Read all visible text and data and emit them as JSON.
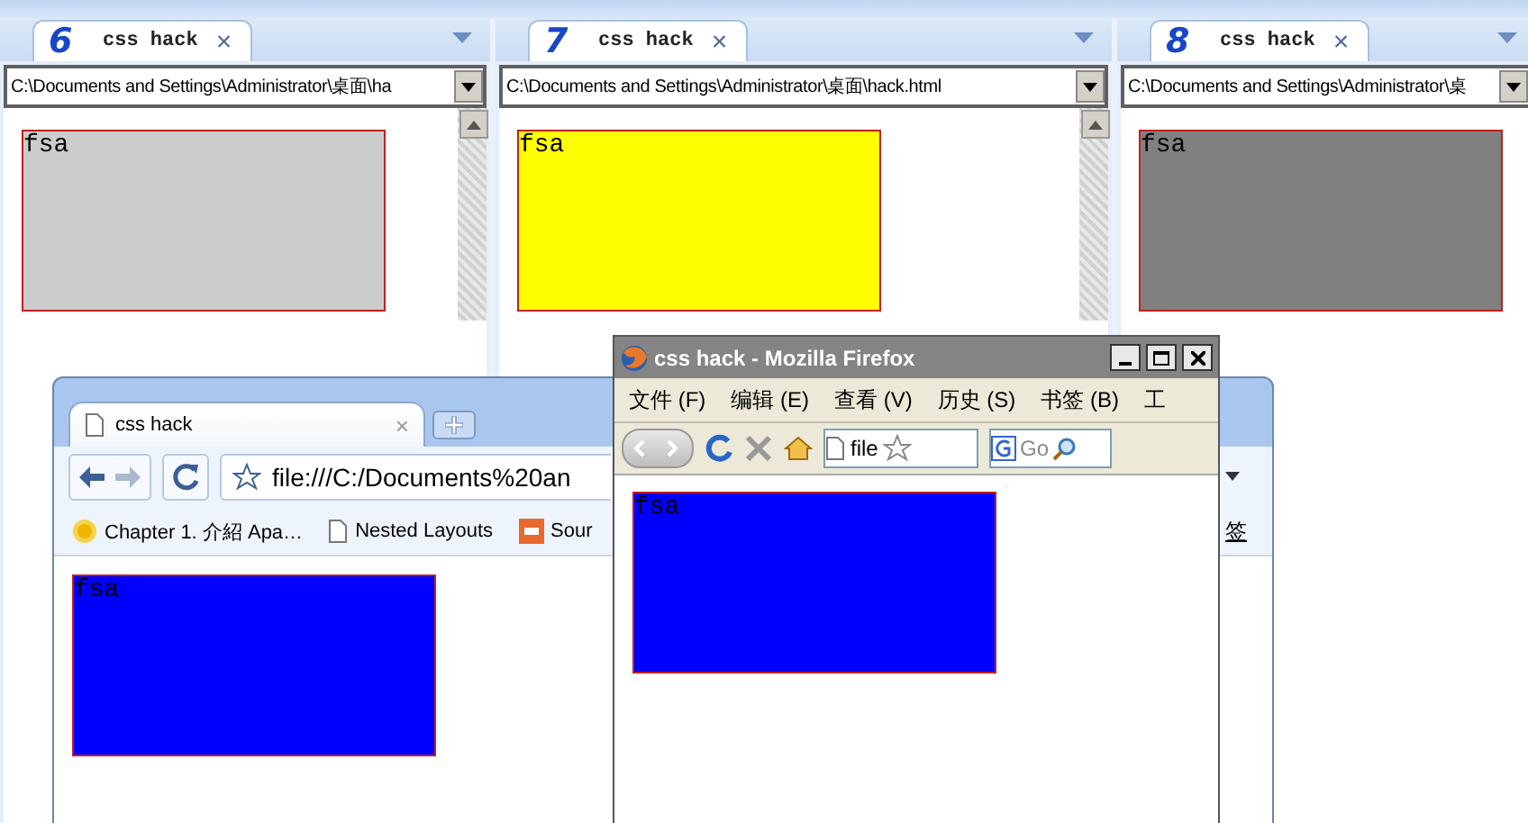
{
  "tabbed_panels": [
    {
      "tab": {
        "number": "6",
        "label": "css hack",
        "close": "×"
      },
      "address": "C:\\Documents and Settings\\Administrator\\桌面\\ha",
      "scrollbar": true,
      "page_box": {
        "text": "fsa",
        "color": "#cccccc"
      }
    },
    {
      "tab": {
        "number": "7",
        "label": "css hack",
        "close": "×"
      },
      "address": "C:\\Documents and Settings\\Administrator\\桌面\\hack.html",
      "scrollbar": true,
      "page_box": {
        "text": "fsa",
        "color": "#ffff00"
      }
    },
    {
      "tab": {
        "number": "8",
        "label": "css hack",
        "close": "×"
      },
      "address": "C:\\Documents and Settings\\Administrator\\桌",
      "scrollbar": false,
      "page_box": {
        "text": "fsa",
        "color": "#808080"
      }
    }
  ],
  "chrome_window": {
    "tab": {
      "label": "css hack",
      "close": "×"
    },
    "url": "file:///C:/Documents%20an",
    "bookmarks": [
      {
        "kind": "sun",
        "label": "Chapter 1. 介紹 Apa…"
      },
      {
        "kind": "page",
        "label": "Nested Layouts"
      },
      {
        "kind": "sf",
        "label": "Sour"
      }
    ],
    "right_label": "签",
    "page_box": {
      "text": "fsa",
      "color": "#0000ff"
    }
  },
  "firefox_window": {
    "title": "css hack - Mozilla Firefox",
    "menus": [
      "文件 (F)",
      "编辑 (E)",
      "查看 (V)",
      "历史 (S)",
      "书签 (B)",
      "工"
    ],
    "url": "file",
    "search_placeholder": "Go",
    "page_box": {
      "text": "fsa",
      "color": "#0000ff"
    }
  }
}
